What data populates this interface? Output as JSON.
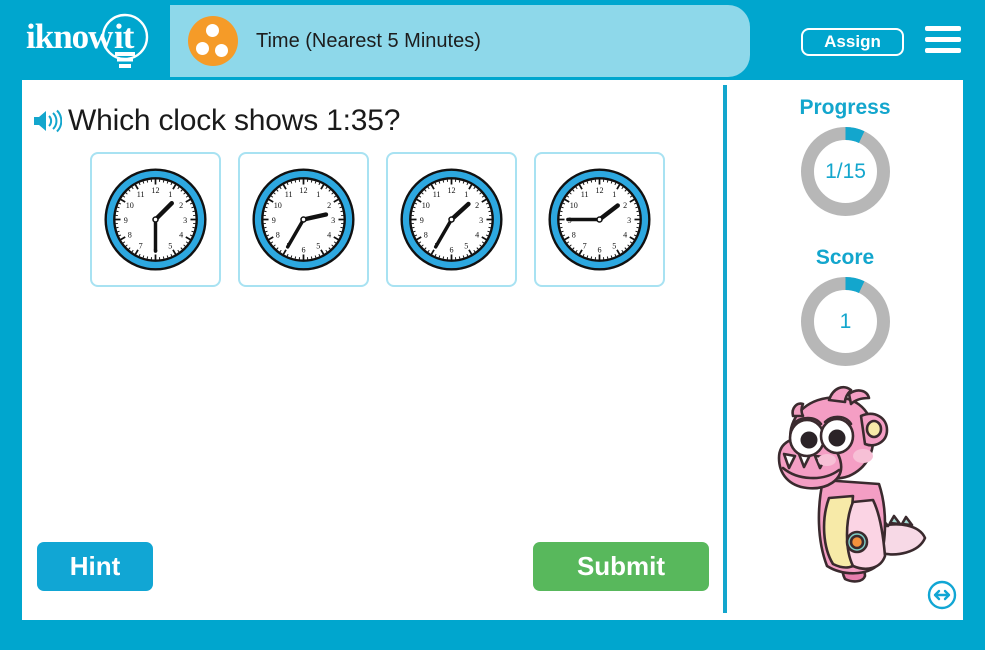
{
  "brand": {
    "logo_text": "iknowit",
    "logo_icon": "lightbulb-icon",
    "header_bg": "#00a6ce"
  },
  "header": {
    "tab_bg": "#8ed8ea",
    "category_icon": "three-dots-circle-icon",
    "category_color": "#f59b28",
    "title": "Time (Nearest 5 Minutes)",
    "assign_label": "Assign",
    "menu_icon": "hamburger-menu-icon"
  },
  "question": {
    "audio_icon": "speaker-icon",
    "text": "Which clock shows 1:35?"
  },
  "choices": [
    {
      "name": "choice-a",
      "clock_time": "1:30",
      "hour": 1,
      "minute": 30
    },
    {
      "name": "choice-b",
      "clock_time": "2:35",
      "hour": 2,
      "minute": 35
    },
    {
      "name": "choice-c",
      "clock_time": "1:35",
      "hour": 1,
      "minute": 35
    },
    {
      "name": "choice-d",
      "clock_time": "1:45",
      "hour": 1,
      "minute": 45
    }
  ],
  "actions": {
    "hint_label": "Hint",
    "hint_color": "#11a6d4",
    "submit_label": "Submit",
    "submit_color": "#58b85c"
  },
  "panel": {
    "progress_label": "Progress",
    "progress_value": "1/15",
    "progress_percent": 7,
    "score_label": "Score",
    "score_value": "1",
    "score_percent": 7,
    "accent_color": "#13a6cd",
    "track_color": "#b7b7b7",
    "mascot_icon": "pink-monster-mascot",
    "resize_icon": "resize-horizontal-icon"
  }
}
